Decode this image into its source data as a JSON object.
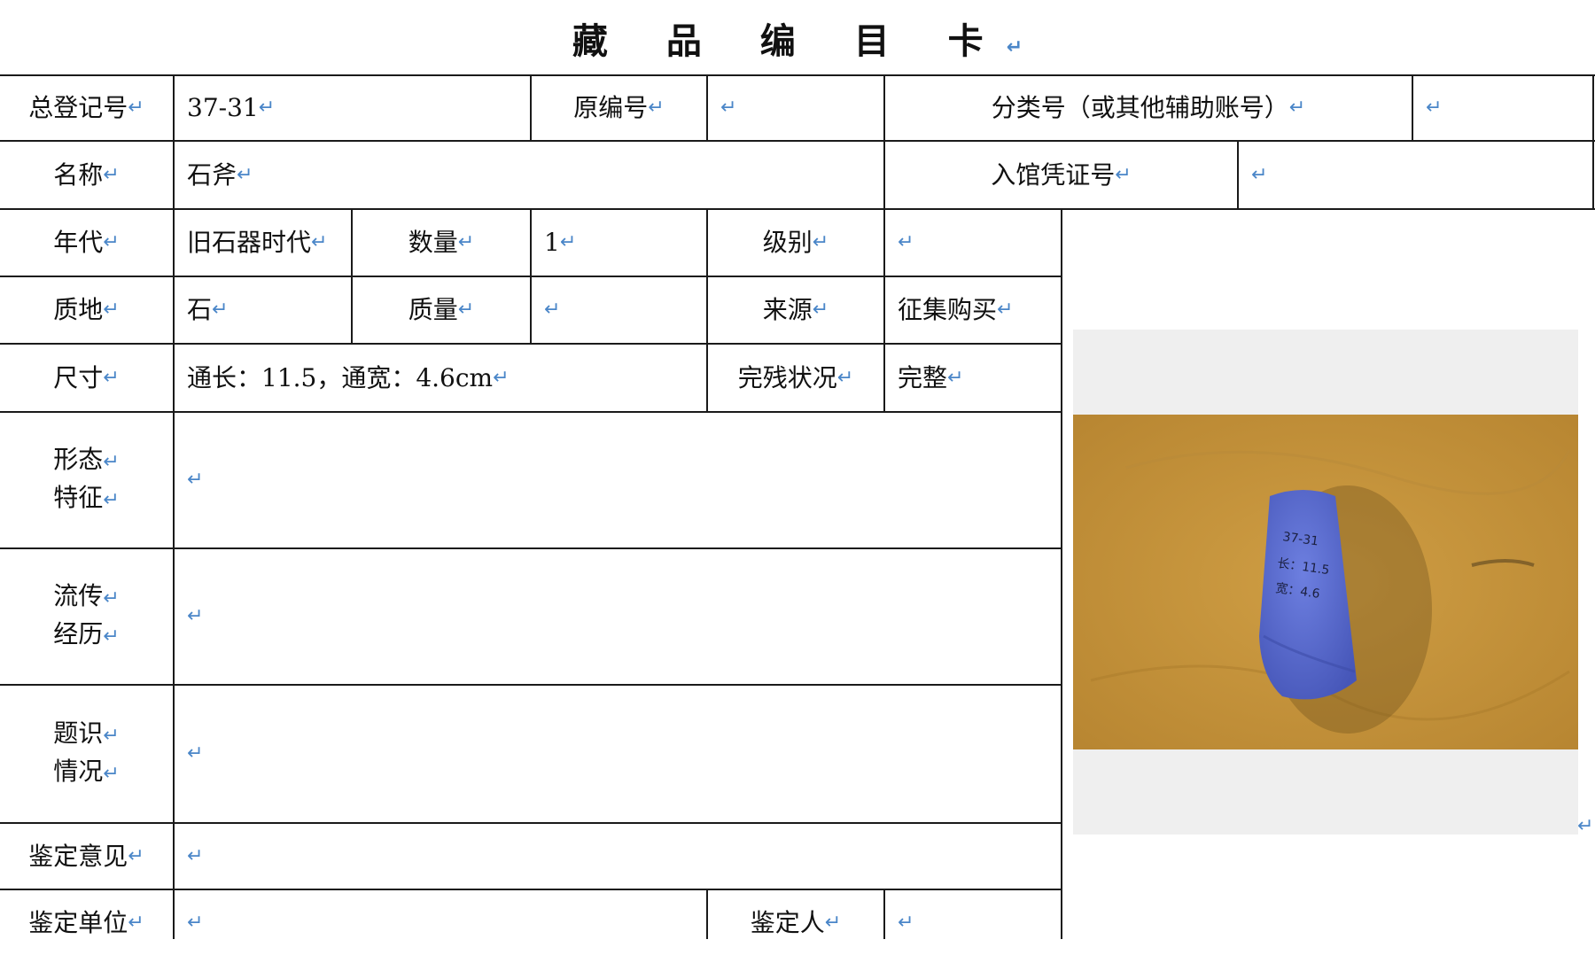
{
  "title": "藏 品 编 目 卡",
  "return_mark": "↵",
  "labels": {
    "total_reg_no": "总登记号",
    "orig_no": "原编号",
    "class_no": "分类号（或其他辅助账号）",
    "name": "名称",
    "entry_voucher": "入馆凭证号",
    "era": "年代",
    "quantity": "数量",
    "grade": "级别",
    "material": "质地",
    "mass": "质量",
    "source": "来源",
    "size": "尺寸",
    "condition": "完残状况",
    "form_1": "形态",
    "form_2": "特征",
    "history_1": "流传",
    "history_2": "经历",
    "inscr_1": "题识",
    "inscr_2": "情况",
    "opinion": "鉴定意见",
    "unit": "鉴定单位",
    "appraiser": "鉴定人"
  },
  "values": {
    "total_reg_no": "37-31",
    "name": "石斧",
    "era": "旧石器时代",
    "quantity": "1",
    "material": "石",
    "source": "征集购买",
    "size": "通长：11.5，通宽：4.6cm",
    "condition": "完整"
  },
  "photo": {
    "subject": "blue stone axe on tan background",
    "inscription": [
      "37-31",
      "长：11.5",
      "宽：4.6"
    ],
    "colors": {
      "background": "#c4923a",
      "stone": "#5b6fd0"
    }
  }
}
